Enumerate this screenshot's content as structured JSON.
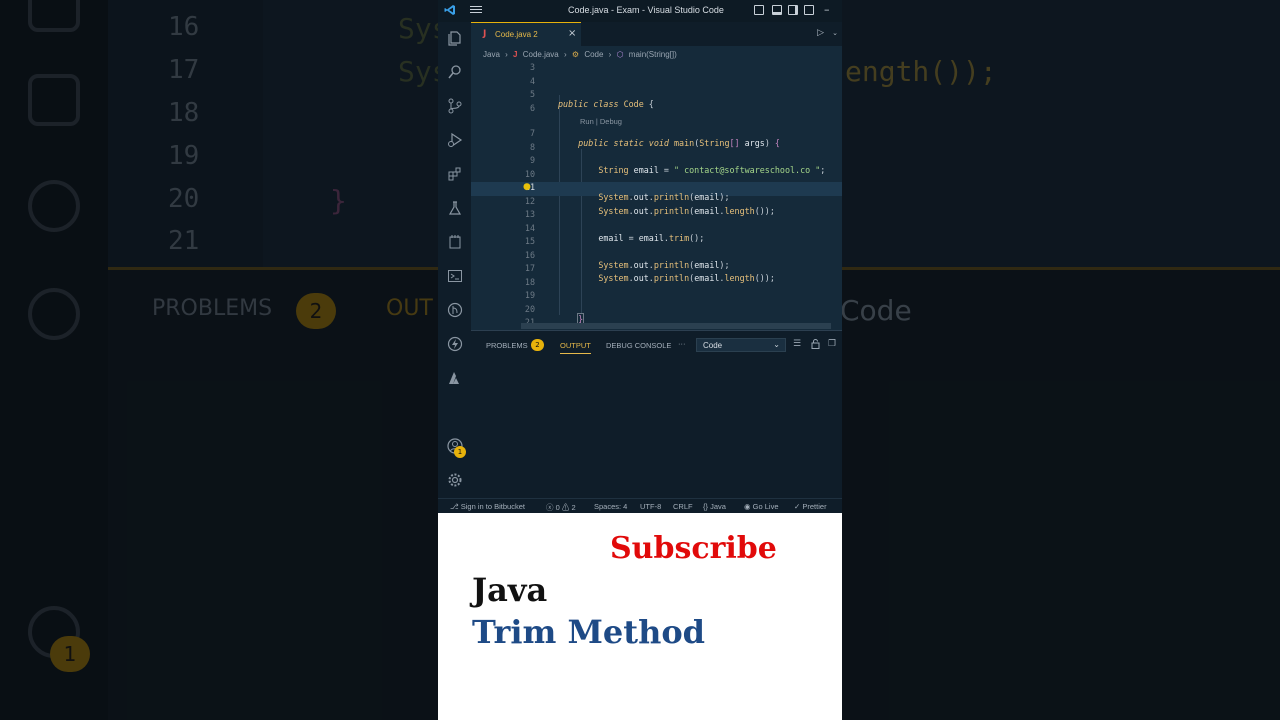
{
  "window": {
    "title": "Code.java - Exam - Visual Studio Code"
  },
  "tab": {
    "label": "Code.java 2",
    "close": "×"
  },
  "breadcrumbs": [
    "Java",
    "Code.java",
    "Code",
    "main(String[])"
  ],
  "codelens": "Run | Debug",
  "code_lines": [
    {
      "n": "3",
      "text": ""
    },
    {
      "n": "4",
      "text": ""
    },
    {
      "n": "5",
      "text": "public class Code {"
    },
    {
      "n": "6",
      "text": ""
    },
    {
      "n": "7",
      "text": "    public static void main(String[] args) {"
    },
    {
      "n": "8",
      "text": ""
    },
    {
      "n": "9",
      "text": "        String email = \" contact@softwareschool.co \";"
    },
    {
      "n": "10",
      "text": ""
    },
    {
      "n": "11",
      "text": "        System.out.println(email);"
    },
    {
      "n": "12",
      "text": "        System.out.println(email.length());"
    },
    {
      "n": "13",
      "text": ""
    },
    {
      "n": "14",
      "text": "        email = email.trim();"
    },
    {
      "n": "15",
      "text": ""
    },
    {
      "n": "16",
      "text": "        System.out.println(email);"
    },
    {
      "n": "17",
      "text": "        System.out.println(email.length());"
    },
    {
      "n": "18",
      "text": ""
    },
    {
      "n": "19",
      "text": ""
    },
    {
      "n": "20",
      "text": "    }"
    },
    {
      "n": "21",
      "text": ""
    }
  ],
  "panel": {
    "tabs": [
      "PROBLEMS",
      "OUTPUT",
      "DEBUG CONSOLE"
    ],
    "problems_count": "2",
    "more": "···",
    "output_channel": "Code"
  },
  "activity_badge": "1",
  "status": {
    "bitbucket": "Sign in to Bitbucket",
    "errors": "0",
    "warnings": "2",
    "spaces": "Spaces: 4",
    "encoding": "UTF-8",
    "eol": "CRLF",
    "language": "Java",
    "golive": "Go Live",
    "prettier": "Prettier"
  },
  "promo": {
    "subscribe": "Subscribe",
    "line1": "Java",
    "line2": "Trim Method"
  },
  "background": {
    "line_numbers": [
      "16",
      "17",
      "18",
      "19",
      "20",
      "21"
    ],
    "code_fragments": [
      "Sys",
      "Sys",
      "ength());",
      "}"
    ],
    "panel_labels": [
      "PROBLEMS",
      "OUT"
    ],
    "panel_badge": "2",
    "channel": "Code",
    "activity_badge": "1"
  },
  "colors": {
    "accent": "#e6b94a",
    "subscribe": "#e10a0a",
    "trim_title": "#1e4a86",
    "editor_bg": "#152a3a"
  }
}
